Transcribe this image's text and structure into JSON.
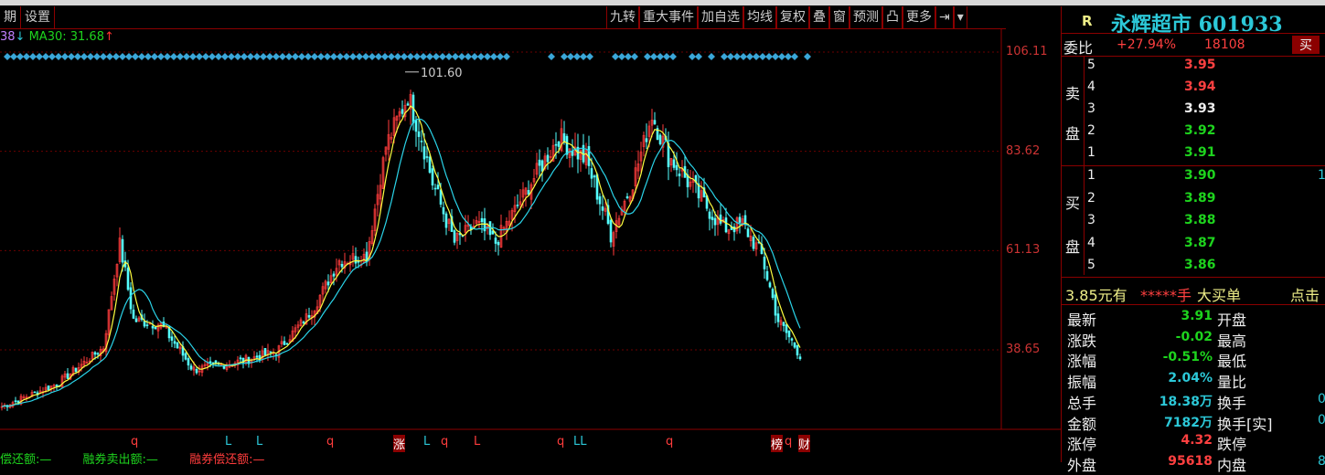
{
  "toolbar": {
    "left": [
      "期",
      "设置"
    ],
    "right": [
      "九转",
      "重大事件",
      "加自选",
      "均线",
      "复权",
      "叠",
      "窗",
      "预测",
      "凸",
      "更多",
      "⇥",
      "▾"
    ]
  },
  "ma": {
    "prev": "38",
    "prev_arrow": "↓",
    "ma30": "MA30: 31.68",
    "ma30_arrow": "↑"
  },
  "chart_data": {
    "type": "candlestick",
    "y_ticks": [
      "106.11",
      "83.62",
      "61.13",
      "38.65"
    ],
    "ylim": [
      29.0,
      106.11
    ],
    "peak_label": "101.60",
    "peak": 101.6,
    "anchors_bar": [
      0,
      20,
      37,
      43,
      48,
      58,
      70,
      87,
      100,
      113,
      123,
      133,
      140,
      148,
      153,
      157,
      165,
      173,
      180,
      193,
      203,
      213,
      222,
      230,
      237,
      243,
      253,
      263,
      270,
      277,
      283,
      291
    ],
    "anchors_close": [
      25.8,
      30.9,
      39.2,
      63.0,
      45.4,
      44.4,
      34.1,
      36.1,
      38.2,
      47.5,
      58.9,
      60.0,
      84.8,
      96.2,
      86.9,
      76.6,
      63.0,
      67.2,
      63.0,
      76.6,
      86.9,
      81.7,
      65.1,
      76.6,
      92.0,
      82.7,
      74.4,
      66.1,
      67.2,
      60.0,
      45.4,
      37.6
    ],
    "colors": {
      "up": "#ff3c3c",
      "down": "#54ffff",
      "ma": "#ffff40",
      "ma2": "#2ad3e8"
    }
  },
  "markers": [
    {
      "t": "q",
      "c": "#ff3c3c"
    },
    {
      "t": "L",
      "c": "#2cc8d8"
    },
    {
      "t": "L",
      "c": "#2cc8d8"
    },
    {
      "t": "q",
      "c": "#ff3c3c"
    },
    {
      "t": "涨",
      "c": "#fff"
    },
    {
      "t": "L",
      "c": "#2cc8d8"
    },
    {
      "t": "q",
      "c": "#ff3c3c"
    },
    {
      "t": "L",
      "c": "#ff3c3c"
    },
    {
      "t": "q",
      "c": "#ff3c3c"
    },
    {
      "t": "LL",
      "c": "#2cc8d8"
    },
    {
      "t": "q",
      "c": "#ff3c3c"
    },
    {
      "t": "榜",
      "c": "#fff"
    },
    {
      "t": "q",
      "c": "#ff3c3c"
    },
    {
      "t": "财",
      "c": "#fff"
    }
  ],
  "quote": {
    "r": "R",
    "name": "永辉超市 601933",
    "weibi_label": "委比",
    "weibi": "+27.94%",
    "weicha": "18108",
    "buy_btn": "买",
    "sell_label": [
      "卖",
      "盘"
    ],
    "buy_label": [
      "买",
      "盘"
    ],
    "asks": [
      {
        "n": "5",
        "p": "3.95",
        "c": "red"
      },
      {
        "n": "4",
        "p": "3.94",
        "c": "red"
      },
      {
        "n": "3",
        "p": "3.93",
        "c": "white"
      },
      {
        "n": "2",
        "p": "3.92",
        "c": "green"
      },
      {
        "n": "1",
        "p": "3.91",
        "c": "green"
      }
    ],
    "bids": [
      {
        "n": "1",
        "p": "3.90",
        "v": "1"
      },
      {
        "n": "2",
        "p": "3.89"
      },
      {
        "n": "3",
        "p": "3.88"
      },
      {
        "n": "4",
        "p": "3.87"
      },
      {
        "n": "5",
        "p": "3.86"
      }
    ],
    "bigorder": {
      "price": "3.85元有",
      "stars": "*****手",
      "label": "大买单",
      "click": "点击"
    },
    "stats": [
      {
        "l": "最新",
        "v": "3.91",
        "c": "green",
        "r": "开盘",
        "rv": ""
      },
      {
        "l": "涨跌",
        "v": "-0.02",
        "c": "green",
        "r": "最高",
        "rv": ""
      },
      {
        "l": "涨幅",
        "v": "-0.51%",
        "c": "green",
        "r": "最低",
        "rv": ""
      },
      {
        "l": "振幅",
        "v": "2.04%",
        "c": "cyan",
        "r": "量比",
        "rv": ""
      },
      {
        "l": "总手",
        "v": "18.38万",
        "c": "cyan",
        "r": "换手",
        "rv": "0"
      },
      {
        "l": "金额",
        "v": "7182万",
        "c": "cyan",
        "r": "换手[实]",
        "rv": "0"
      },
      {
        "l": "涨停",
        "v": "4.32",
        "c": "red",
        "r": "跌停",
        "rv": ""
      },
      {
        "l": "外盘",
        "v": "95618",
        "c": "red",
        "r": "内盘",
        "rv": "8"
      }
    ]
  },
  "bottom": [
    "偿还额:—",
    "融券卖出额:—",
    "融券偿还额:—"
  ]
}
